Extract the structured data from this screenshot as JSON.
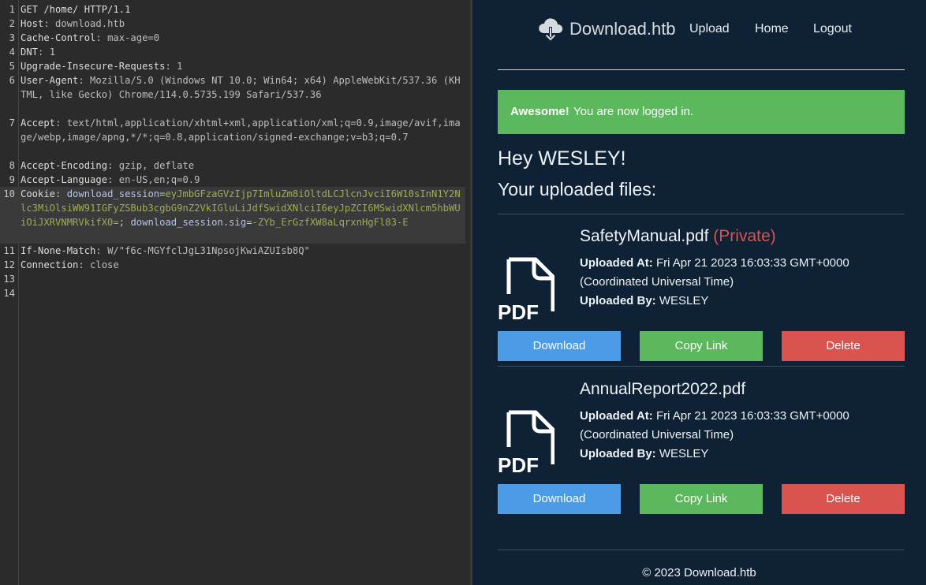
{
  "request": {
    "lines": [
      {
        "num": "1",
        "parts": [
          {
            "t": "GET /home/ HTTP/1.1",
            "c": "hn"
          }
        ]
      },
      {
        "num": "2",
        "parts": [
          {
            "t": "Host",
            "c": "hn"
          },
          {
            "t": ": download.htb",
            "c": "hv"
          }
        ]
      },
      {
        "num": "3",
        "parts": [
          {
            "t": "Cache-Control",
            "c": "hn"
          },
          {
            "t": ": max-age=0",
            "c": "hv"
          }
        ]
      },
      {
        "num": "4",
        "parts": [
          {
            "t": "DNT",
            "c": "hn"
          },
          {
            "t": ": 1",
            "c": "hv"
          }
        ]
      },
      {
        "num": "5",
        "parts": [
          {
            "t": "Upgrade-Insecure-Requests",
            "c": "hn"
          },
          {
            "t": ": 1",
            "c": "hv"
          }
        ]
      },
      {
        "num": "6",
        "parts": [
          {
            "t": "User-Agent",
            "c": "hn"
          },
          {
            "t": ": Mozilla/5.0 (Windows NT 10.0; Win64; x64) AppleWebKit/537.36 (KHTML, like Gecko) Chrome/114.0.5735.199 Safari/537.36",
            "c": "hv"
          }
        ]
      },
      {
        "num": "7",
        "parts": [
          {
            "t": "Accept",
            "c": "hn"
          },
          {
            "t": ": text/html,application/xhtml+xml,application/xml;q=0.9,image/avif,image/webp,image/apng,*/*;q=0.8,application/signed-exchange;v=b3;q=0.7",
            "c": "hv"
          }
        ]
      },
      {
        "num": "8",
        "parts": [
          {
            "t": "Accept-Encoding",
            "c": "hn"
          },
          {
            "t": ": gzip, deflate",
            "c": "hv"
          }
        ]
      },
      {
        "num": "9",
        "parts": [
          {
            "t": "Accept-Language",
            "c": "hn"
          },
          {
            "t": ": en-US,en;q=0.9",
            "c": "hv"
          }
        ]
      },
      {
        "num": "10",
        "parts": [
          {
            "t": "Cookie",
            "c": "hn"
          },
          {
            "t": ": ",
            "c": "sep"
          },
          {
            "t": "download_session",
            "c": "ck"
          },
          {
            "t": "=",
            "c": "sep"
          },
          {
            "t": "eyJmbGFzaGVzIjp7ImluZm8iOltdLCJlcnJvciI6W10sInN1Y2Nlc3MiOlsiWW91IGFyZSBub3cgbG9nZ2VkIGluLiJdfSwidXNlciI6eyJpZCI6MSwidXNlcm5hbWUiOiJXRVNMRVkifX0=",
            "c": "cv"
          },
          {
            "t": "; ",
            "c": "sep"
          },
          {
            "t": "download_session.sig",
            "c": "ck"
          },
          {
            "t": "=",
            "c": "sep"
          },
          {
            "t": "-ZYb_ErGzfXW8aLqrxnHgFl83-E",
            "c": "cv"
          }
        ]
      },
      {
        "num": "11",
        "parts": [
          {
            "t": "If-None-Match",
            "c": "hn"
          },
          {
            "t": ": W/\"f6c-MGYfclJgL31NpsojKwiAZUIsb8Q\"",
            "c": "hv"
          }
        ]
      },
      {
        "num": "12",
        "parts": [
          {
            "t": "Connection",
            "c": "hn"
          },
          {
            "t": ": close",
            "c": "hv"
          }
        ]
      },
      {
        "num": "13",
        "parts": []
      },
      {
        "num": "14",
        "parts": []
      }
    ]
  },
  "site": {
    "brand": "Download.htb",
    "nav": {
      "upload": "Upload",
      "home": "Home",
      "logout": "Logout"
    },
    "alert": {
      "strong": "Awesome!",
      "text": "You are now logged in."
    },
    "greeting": "Hey WESLEY!",
    "subhead": "Your uploaded files:",
    "files": [
      {
        "name": "SafetyManual.pdf",
        "private": "(Private)",
        "uploaded_at_label": "Uploaded At:",
        "uploaded_at": "Fri Apr 21 2023 16:03:33 GMT+0000 (Coordinated Universal Time)",
        "uploaded_by_label": "Uploaded By:",
        "uploaded_by": "WESLEY",
        "buttons": {
          "download": "Download",
          "copy": "Copy Link",
          "delete": "Delete"
        }
      },
      {
        "name": "AnnualReport2022.pdf",
        "private": "",
        "uploaded_at_label": "Uploaded At:",
        "uploaded_at": "Fri Apr 21 2023 16:03:33 GMT+0000 (Coordinated Universal Time)",
        "uploaded_by_label": "Uploaded By:",
        "uploaded_by": "WESLEY",
        "buttons": {
          "download": "Download",
          "copy": "Copy Link",
          "delete": "Delete"
        }
      }
    ],
    "footer": "© 2023 Download.htb"
  },
  "icons": {
    "logo": "cloud-download-icon",
    "file": "pdf-file-icon"
  },
  "colors": {
    "success": "#5cb85c",
    "primary": "#4b9be6",
    "danger": "#d9534f",
    "page_bg": "#0f2134"
  }
}
